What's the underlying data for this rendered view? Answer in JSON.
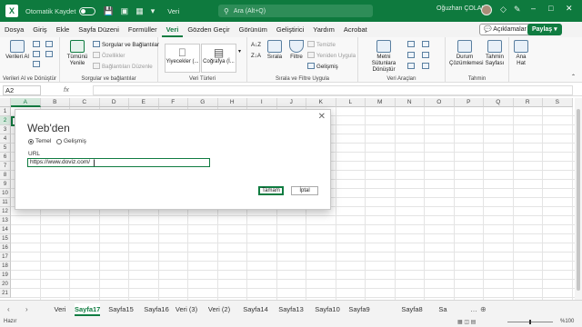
{
  "titlebar": {
    "logo": "X",
    "autosave_label": "Otomatik Kaydet",
    "doc_name": "Veri",
    "search_placeholder": "Ara (Alt+Q)",
    "user_name": "Oğuzhan ÇOLAK",
    "window_controls": [
      "–",
      "□",
      "✕"
    ]
  },
  "menu": {
    "tabs": [
      "Dosya",
      "Giriş",
      "Ekle",
      "Sayfa Düzeni",
      "Formüller",
      "Veri",
      "Gözden Geçir",
      "Görünüm",
      "Geliştirici",
      "Yardım",
      "Acrobat"
    ],
    "active": "Veri",
    "comments_label": "Açıklamalar",
    "share_label": "Paylaş"
  },
  "ribbon": {
    "get_data": {
      "label": "Verileri Al",
      "group": "Verileri Al ve Dönüştür"
    },
    "refresh_all": {
      "label": "Tümünü Yenile"
    },
    "queries": {
      "items": [
        "Sorgular ve Bağlantılar",
        "Özellikler",
        "Bağlantıları Düzenle"
      ],
      "group": "Sorgular ve bağlantılar"
    },
    "data_types": {
      "items": [
        "Yiyecekler (...",
        "Coğrafya (İ..."
      ],
      "group": "Veri Türleri"
    },
    "sort_filter": {
      "sort": "Sırala",
      "filter": "Filtre",
      "clear": "Temizle",
      "reapply": "Yeniden Uygula",
      "advanced": "Gelişmiş",
      "group": "Sırala ve Filtre Uygula"
    },
    "data_tools": {
      "text_to_columns": "Metni Sütunlara Dönüştür",
      "group": "Veri Araçları"
    },
    "forecast": {
      "what_if": "Durum Çözümlemesi",
      "forecast_sheet": "Tahmin Sayfası",
      "group": "Tahmin"
    },
    "outline": {
      "label": "Ana Hat"
    }
  },
  "formula_bar": {
    "name_box": "A2",
    "fx": "fx",
    "value": ""
  },
  "grid": {
    "columns": [
      "A",
      "B",
      "C",
      "D",
      "E",
      "F",
      "G",
      "H",
      "I",
      "J",
      "K",
      "L",
      "M",
      "N",
      "O",
      "P",
      "Q",
      "R",
      "S"
    ],
    "rows": [
      "1",
      "2",
      "3",
      "4",
      "5",
      "6",
      "7",
      "8",
      "9",
      "10",
      "11",
      "12",
      "13",
      "14",
      "15",
      "16",
      "17",
      "18",
      "19",
      "20",
      "21"
    ],
    "active_cell": "A2"
  },
  "dialog": {
    "title": "Web'den",
    "close": "✕",
    "mode_basic": "Temel",
    "mode_advanced": "Gelişmiş",
    "selected_mode": "Temel",
    "url_label": "URL",
    "url_value": "https://www.doviz.com/",
    "ok_label": "Tamam",
    "cancel_label": "İptal"
  },
  "sheets": {
    "tabs": [
      "Veri",
      "Sayfa17",
      "Sayfa15",
      "Sayfa16",
      "Veri (3)",
      "Veri (2)",
      "Sayfa14",
      "Sayfa13",
      "Sayfa10",
      "Sayfa9",
      "Sayfa8",
      "Sa"
    ],
    "active": "Sayfa17"
  },
  "statusbar": {
    "mode": "Hazır",
    "zoom": "%100",
    "zoom_level": 1.0
  }
}
